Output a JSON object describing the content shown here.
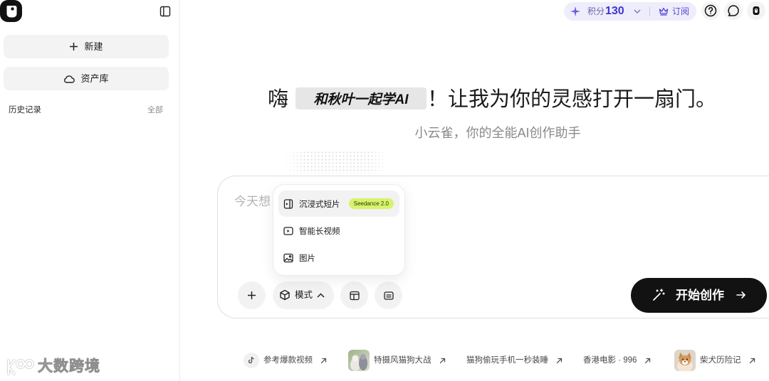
{
  "sidebar": {
    "new_label": "新建",
    "assets_label": "资产库",
    "history_label": "历史记录",
    "history_all_label": "全部"
  },
  "watermark": {
    "text": "大数跨境"
  },
  "topbar": {
    "points_label": "积分",
    "points_value": "130",
    "subscribe_label": "订阅",
    "icons": [
      "sparkle-icon",
      "chevron-down-icon",
      "crown-icon",
      "help-icon",
      "chat-icon",
      "app-mini-icon"
    ]
  },
  "hero": {
    "greeting": "嗨",
    "highlight": "和秋叶一起学AI",
    "headline_rest": "！让我为你的灵感打开一扇门。",
    "subtitle": "小云雀，你的全能AI创作助手"
  },
  "composer": {
    "placeholder": "今天想",
    "mode_label": "模式",
    "start_label": "开始创作",
    "mode_menu": [
      {
        "label": "沉浸式短片",
        "badge": "Seedance 2.0",
        "icon": "film-icon",
        "selected": true
      },
      {
        "label": "智能长视频",
        "icon": "video-icon",
        "selected": false
      },
      {
        "label": "图片",
        "icon": "image-icon",
        "selected": false
      }
    ],
    "tools": [
      "plus-icon",
      "cube-icon",
      "layout-icon",
      "caption-icon"
    ]
  },
  "suggestions": [
    {
      "label": "参考爆款视频",
      "icon": "tiktok-icon"
    },
    {
      "label": "特摄风猫狗大战",
      "icon": "thumbnail-image"
    },
    {
      "label": "猫狗偷玩手机一秒装睡"
    },
    {
      "label": "香港电影 · 996"
    },
    {
      "label": "柴犬历险记",
      "icon": "thumbnail-image"
    }
  ],
  "colors": {
    "accent": "#4034cc",
    "points_bg": "#eeedfb",
    "start_button": "#121212",
    "badge_bg": "#d6f36c",
    "button_bg": "#f2f2f3"
  }
}
